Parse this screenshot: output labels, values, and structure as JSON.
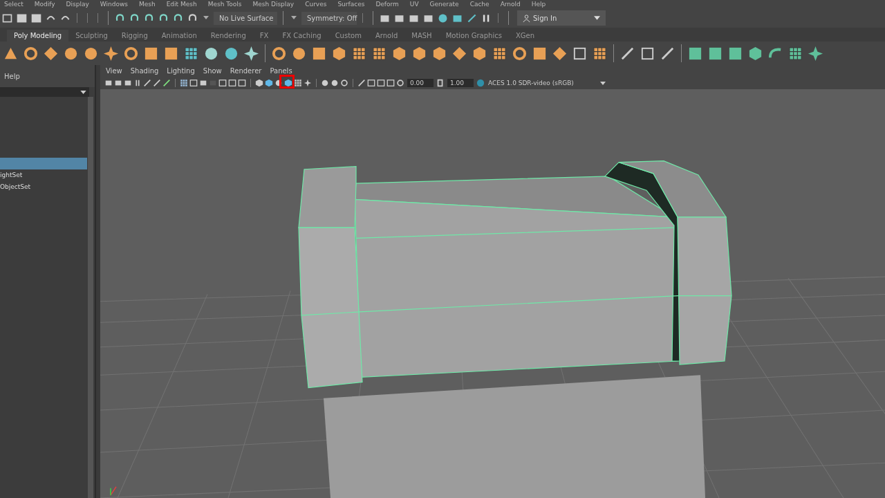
{
  "menu_bar": [
    "Select",
    "Modify",
    "Display",
    "Windows",
    "Mesh",
    "Edit Mesh",
    "Mesh Tools",
    "Mesh Display",
    "Curves",
    "Surfaces",
    "Deform",
    "UV",
    "Generate",
    "Cache",
    "Arnold",
    "Help"
  ],
  "status_line": {
    "live_surface": "No Live Surface",
    "symmetry": "Symmetry: Off",
    "sign_in": "Sign In"
  },
  "shelf_tabs": [
    {
      "label": "Poly Modeling",
      "selected": true
    },
    {
      "label": "Sculpting",
      "selected": false
    },
    {
      "label": "Rigging",
      "selected": false
    },
    {
      "label": "Animation",
      "selected": false
    },
    {
      "label": "Rendering",
      "selected": false
    },
    {
      "label": "FX",
      "selected": false
    },
    {
      "label": "FX Caching",
      "selected": false
    },
    {
      "label": "Custom",
      "selected": false
    },
    {
      "label": "Arnold",
      "selected": false
    },
    {
      "label": "MASH",
      "selected": false
    },
    {
      "label": "Motion Graphics",
      "selected": false
    },
    {
      "label": "XGen",
      "selected": false
    }
  ],
  "outliner": {
    "menu": "Help",
    "rows": [
      {
        "selected": true
      },
      {
        "label": "ightSet",
        "selected": false
      },
      {
        "label": "ObjectSet",
        "selected": false
      }
    ]
  },
  "viewport": {
    "menu": [
      "View",
      "Shading",
      "Lighting",
      "Show",
      "Renderer",
      "Panels"
    ],
    "fields": [
      "0.00",
      "1.00"
    ],
    "color_space": "ACES 1.0 SDR-video (sRGB)"
  }
}
